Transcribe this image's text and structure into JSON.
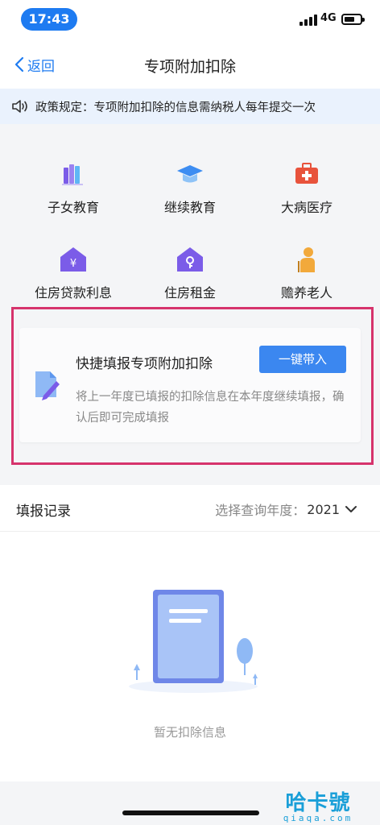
{
  "status": {
    "time": "17:43",
    "network": "4G"
  },
  "nav": {
    "back_label": "返回",
    "title": "专项附加扣除"
  },
  "notice": {
    "text": "政策规定：专项附加扣除的信息需纳税人每年提交一次"
  },
  "categories": [
    {
      "label": "子女教育",
      "icon": "books-icon"
    },
    {
      "label": "继续教育",
      "icon": "graduation-cap-icon"
    },
    {
      "label": "大病医疗",
      "icon": "medical-kit-icon"
    },
    {
      "label": "住房贷款利息",
      "icon": "house-yuan-icon"
    },
    {
      "label": "住房租金",
      "icon": "house-key-icon"
    },
    {
      "label": "赡养老人",
      "icon": "elderly-person-icon"
    }
  ],
  "quick_fill": {
    "title": "快捷填报专项附加扣除",
    "button": "一键带入",
    "description": "将上一年度已填报的扣除信息在本年度继续填报，确认后即可完成填报"
  },
  "records": {
    "title": "填报记录",
    "year_prompt": "选择查询年度：",
    "year": "2021",
    "empty_text": "暂无扣除信息"
  },
  "watermark": {
    "main": "哈卡號",
    "sub": "qiaqa.com"
  },
  "colors": {
    "accent": "#1e7bf1",
    "highlight": "#d6336c",
    "category_purple": "#7b5ce8",
    "medical_red": "#e8533c"
  }
}
